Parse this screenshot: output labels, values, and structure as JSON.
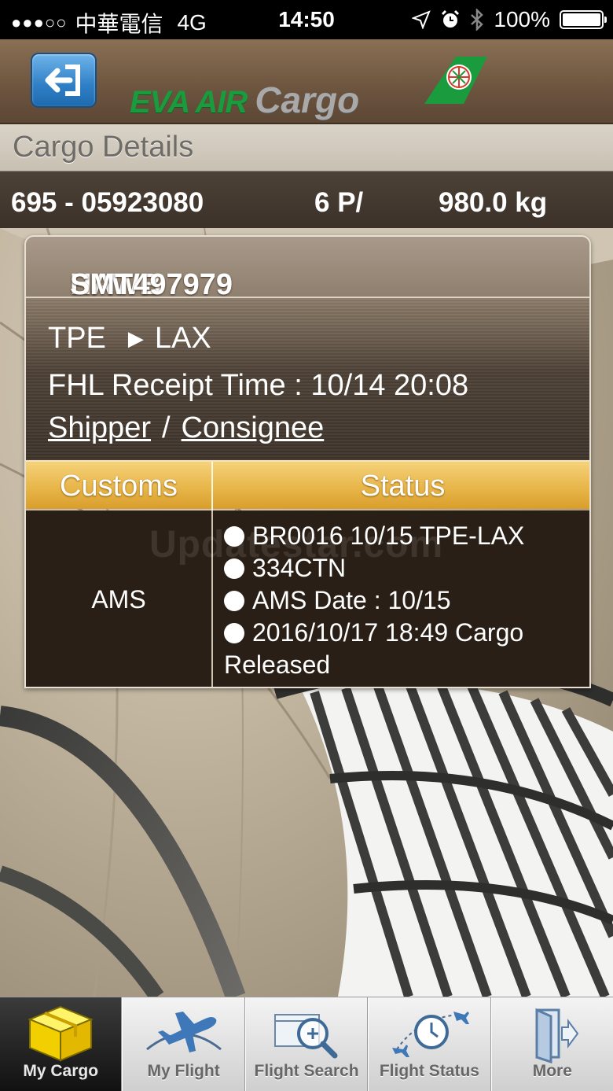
{
  "status_bar": {
    "carrier": "中華電信",
    "network": "4G",
    "time": "14:50",
    "battery": "100%"
  },
  "header": {
    "brand_primary": "EVA AIR",
    "brand_secondary": "Cargo",
    "colors": {
      "brand_green": "#1a9b3e",
      "back_button_blue": "#2f7fc6"
    }
  },
  "page_title": "Cargo Details",
  "summary": {
    "awb": "695 - 05923080",
    "pieces": "6 P/",
    "weight": "980.0 kg"
  },
  "detail": {
    "hawb_label": "HAWB :",
    "hawb_value": "SMT497979",
    "origin": "TPE",
    "destination": "LAX",
    "fhl_label": "FHL Receipt Time :",
    "fhl_value": "10/14 20:08",
    "shipper_link": "Shipper",
    "separator": "/",
    "consignee_link": "Consignee"
  },
  "table": {
    "headers": [
      "Customs",
      "Status"
    ],
    "customs_value": "AMS",
    "status_lines": [
      "BR0016 10/15 TPE-LAX",
      "334CTN",
      "AMS Date : 10/15",
      "2016/10/17 18:49 Cargo Released"
    ],
    "colors": {
      "header_gold": "#e8b64a",
      "body_dark": "#2a1f16"
    }
  },
  "watermark": "Updatestar.com",
  "tabs": [
    {
      "label": "My Cargo",
      "icon": "cargo-box-icon",
      "active": true
    },
    {
      "label": "My Flight",
      "icon": "airplane-icon",
      "active": false
    },
    {
      "label": "Flight Search",
      "icon": "magnifier-icon",
      "active": false
    },
    {
      "label": "Flight Status",
      "icon": "clock-planes-icon",
      "active": false
    },
    {
      "label": "More",
      "icon": "door-exit-icon",
      "active": false
    }
  ]
}
